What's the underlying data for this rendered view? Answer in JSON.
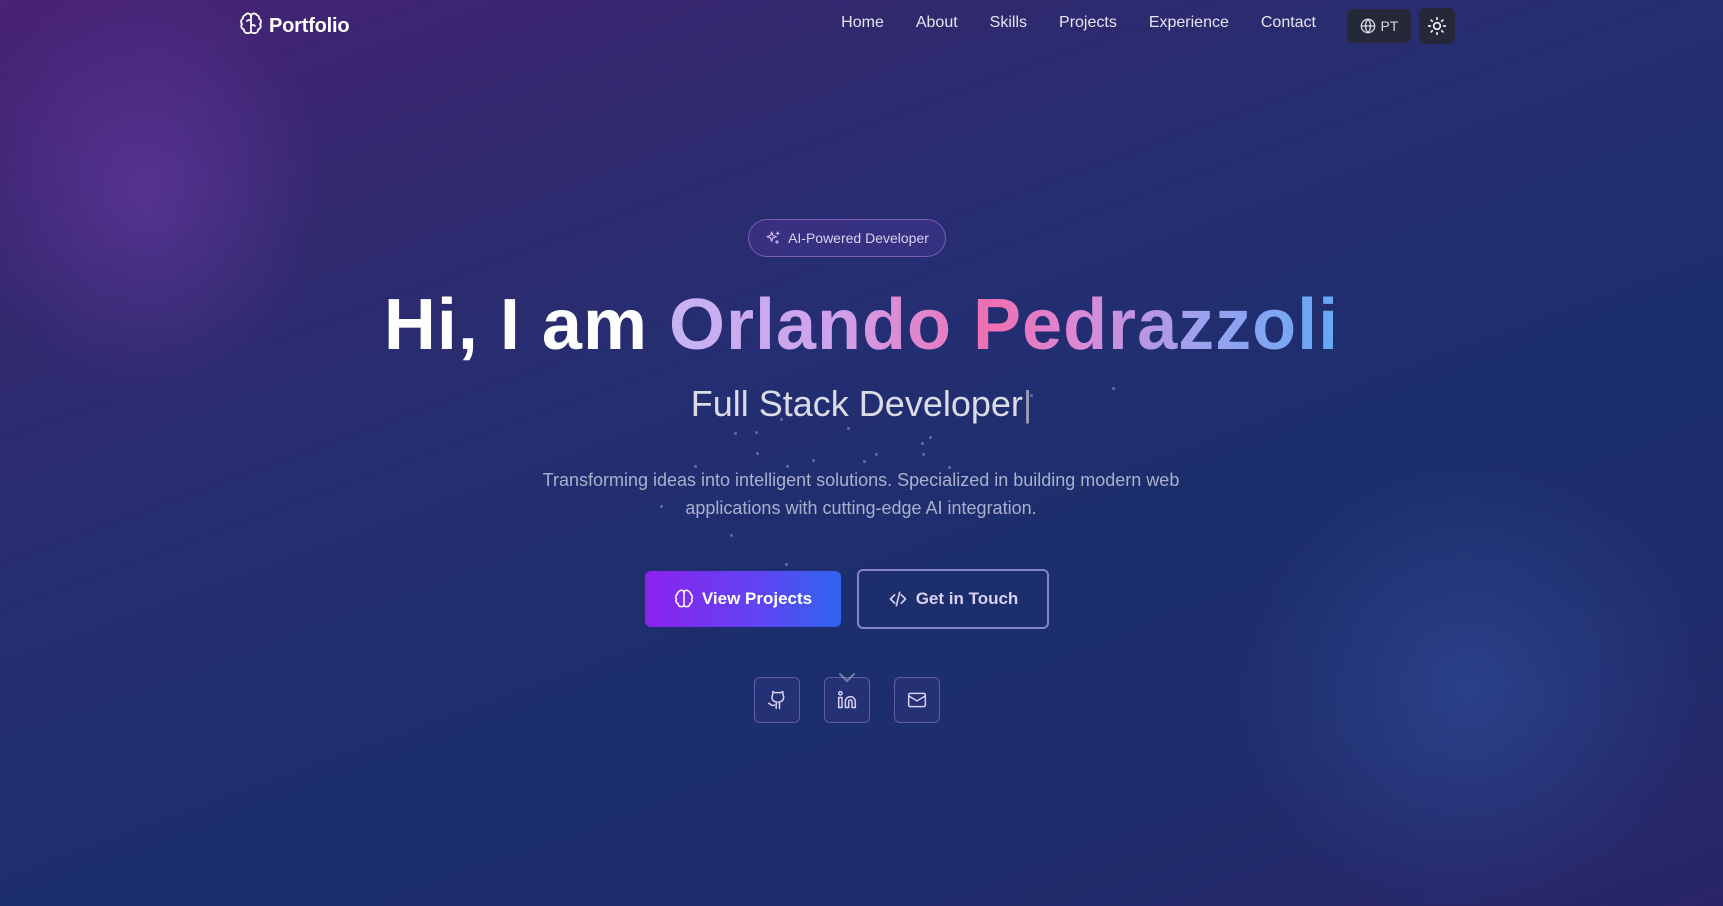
{
  "nav": {
    "brand": "Portfolio",
    "brand_icon": "brain-icon",
    "links": [
      "Home",
      "About",
      "Skills",
      "Projects",
      "Experience",
      "Contact"
    ],
    "language_label": "PT",
    "language_icon": "globe-icon",
    "theme_icon": "sun-icon"
  },
  "hero": {
    "badge": "AI-Powered Developer",
    "badge_icon": "sparkles-icon",
    "greeting": "Hi, I am",
    "name": "Orlando Pedrazzoli",
    "role": "Full Stack Developer",
    "cursor": "|",
    "description": "Transforming ideas into intelligent solutions. Specialized in building modern web applications with cutting-edge AI integration.",
    "primary_button": "View Projects",
    "primary_button_icon": "brain-icon",
    "secondary_button": "Get in Touch",
    "secondary_button_icon": "code-icon",
    "social_icons": [
      "github-icon",
      "linkedin-icon",
      "mail-icon"
    ],
    "scroll_icon": "chevron-down-icon"
  },
  "colors": {
    "primary_gradient_start": "#8c22ee",
    "primary_gradient_end": "#2f64f0",
    "name_gradient": [
      "#c7b3f5",
      "#ee6fb2",
      "#64a8f5"
    ],
    "nav_button_bg": "#252838"
  }
}
